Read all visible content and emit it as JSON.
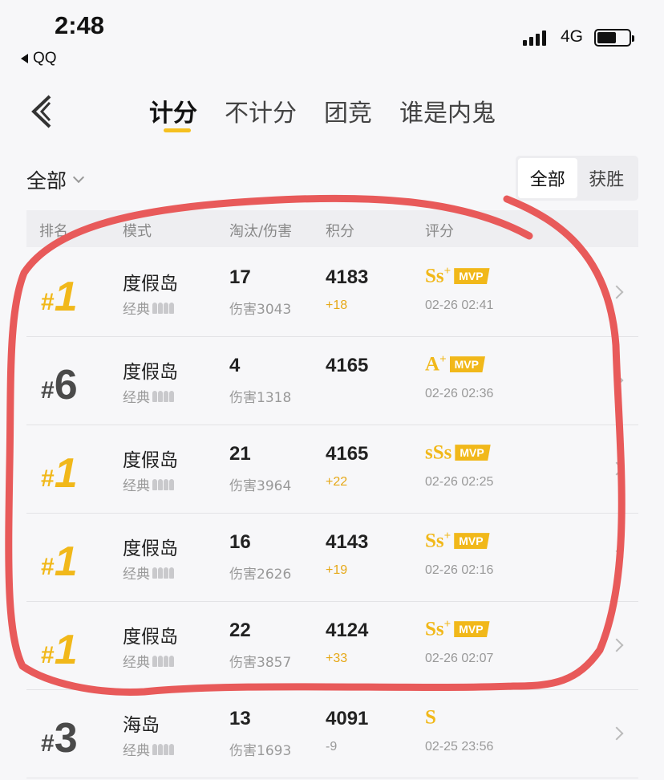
{
  "status_bar": {
    "time": "2:48",
    "back_app": "QQ",
    "network": "4G"
  },
  "tabs": [
    {
      "label": "计分",
      "active": true
    },
    {
      "label": "不计分",
      "active": false
    },
    {
      "label": "团竞",
      "active": false
    },
    {
      "label": "谁是内鬼",
      "active": false
    }
  ],
  "filter": {
    "dropdown_label": "全部",
    "segments": [
      "全部",
      "获胜"
    ],
    "selected_segment": 0
  },
  "table_headers": {
    "rank": "排名",
    "mode": "模式",
    "kills": "淘汰/伤害",
    "score": "积分",
    "rating": "评分"
  },
  "rows": [
    {
      "rank": "1",
      "mode": "度假岛",
      "sub": "经典",
      "kills": "17",
      "damage": "伤害3043",
      "score": "4183",
      "delta": "+18",
      "grade": "Ss",
      "grade_sup": "+",
      "mvp": "MVP",
      "date": "02-26 02:41"
    },
    {
      "rank": "6",
      "mode": "度假岛",
      "sub": "经典",
      "kills": "4",
      "damage": "伤害1318",
      "score": "4165",
      "delta": "",
      "grade": "A",
      "grade_sup": "+",
      "mvp": "MVP",
      "date": "02-26 02:36"
    },
    {
      "rank": "1",
      "mode": "度假岛",
      "sub": "经典",
      "kills": "21",
      "damage": "伤害3964",
      "score": "4165",
      "delta": "+22",
      "grade": "sSs",
      "grade_sup": "",
      "mvp": "MVP",
      "date": "02-26 02:25"
    },
    {
      "rank": "1",
      "mode": "度假岛",
      "sub": "经典",
      "kills": "16",
      "damage": "伤害2626",
      "score": "4143",
      "delta": "+19",
      "grade": "Ss",
      "grade_sup": "+",
      "mvp": "MVP",
      "date": "02-26 02:16"
    },
    {
      "rank": "1",
      "mode": "度假岛",
      "sub": "经典",
      "kills": "22",
      "damage": "伤害3857",
      "score": "4124",
      "delta": "+33",
      "grade": "Ss",
      "grade_sup": "+",
      "mvp": "MVP",
      "date": "02-26 02:07"
    },
    {
      "rank": "3",
      "mode": "海岛",
      "sub": "经典",
      "kills": "13",
      "damage": "伤害1693",
      "score": "4091",
      "delta": "-9",
      "grade": "S",
      "grade_sup": "",
      "mvp": "",
      "date": "02-25 23:56"
    }
  ],
  "colors": {
    "accent": "#f1b81a",
    "annotation": "#e85a5a"
  }
}
